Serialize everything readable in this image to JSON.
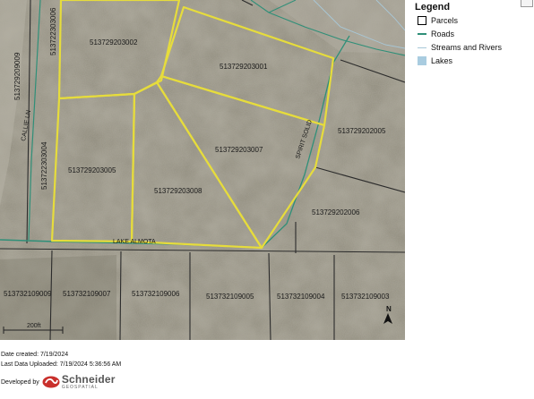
{
  "legend": {
    "title": "Legend",
    "items": [
      {
        "label": "Parcels",
        "symbol": "parcel-outline",
        "color": "#000000"
      },
      {
        "label": "Roads",
        "symbol": "road-line",
        "color": "#2f8f78"
      },
      {
        "label": "Streams and Rivers",
        "symbol": "stream-line",
        "color": "#a8c8d8"
      },
      {
        "label": "Lakes",
        "symbol": "lake-fill",
        "color": "#a9cce0"
      }
    ]
  },
  "map": {
    "highlight_color": "#e6dc3c",
    "parcels": [
      {
        "id": "513729203002"
      },
      {
        "id": "513729203001"
      },
      {
        "id": "513729203007"
      },
      {
        "id": "513729203005"
      },
      {
        "id": "513729203008"
      },
      {
        "id": "513729202005"
      },
      {
        "id": "513729202006"
      },
      {
        "id": "513722303004"
      },
      {
        "id": "513722303006"
      },
      {
        "id": "513729209009"
      },
      {
        "id": "513732109009"
      },
      {
        "id": "513732109007"
      },
      {
        "id": "513732109006"
      },
      {
        "id": "513732109005"
      },
      {
        "id": "513732109004"
      },
      {
        "id": "513732109003"
      }
    ],
    "roads": [
      {
        "name": "LAKE ALMOTA"
      },
      {
        "name": "CALLIE LN"
      },
      {
        "name": "SPIRIT SOLID"
      }
    ],
    "north_arrow": "N",
    "scale_text": "200ft"
  },
  "footer": {
    "date_created": "Date created: 7/19/2024",
    "last_uploaded": "Last Data Uploaded: 7/19/2024 5:36:56 AM",
    "developed_by": "Developed by",
    "logo_name": "Schneider",
    "logo_sub": "GEOSPATIAL"
  }
}
